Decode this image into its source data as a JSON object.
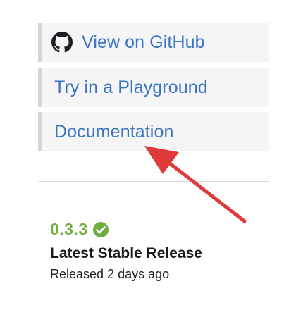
{
  "links": {
    "github": {
      "label": "View on GitHub",
      "icon": "github-icon"
    },
    "playground": {
      "label": "Try in a Playground"
    },
    "docs": {
      "label": "Documentation"
    }
  },
  "release": {
    "version": "0.3.3",
    "status_icon": "check-circle-icon",
    "title": "Latest Stable Release",
    "released": "Released 2 days ago"
  },
  "annotation": {
    "type": "arrow",
    "icon": "red-arrow-annotation",
    "color": "#e0393a",
    "points_to": "Documentation"
  },
  "colors": {
    "link": "#3b74c5",
    "version": "#6fad3e",
    "link_background": "#f5f5f5",
    "link_border": "#d6d6d6"
  }
}
